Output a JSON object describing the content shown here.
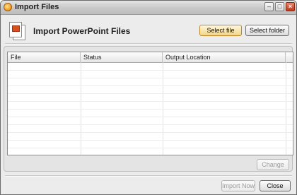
{
  "window": {
    "title": "Import Files"
  },
  "header": {
    "title": "Import PowerPoint Files"
  },
  "toolbar": {
    "select_file": "Select file",
    "select_folder": "Select folder"
  },
  "table": {
    "columns": [
      "File",
      "Status",
      "Output Location"
    ],
    "rows": []
  },
  "actions": {
    "change": "Change",
    "import_now": "Import Now",
    "close": "Close"
  }
}
